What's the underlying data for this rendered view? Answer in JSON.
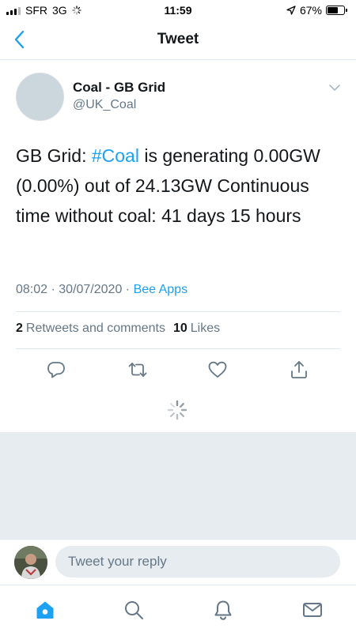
{
  "status_bar": {
    "carrier": "SFR",
    "network": "3G",
    "time": "11:59",
    "battery": "67%",
    "battery_level": 0.67
  },
  "nav": {
    "title": "Tweet"
  },
  "tweet": {
    "display_name": "Coal - GB Grid",
    "handle": "@UK_Coal",
    "text_before": "GB Grid: ",
    "hashtag": "#Coal",
    "text_after": " is generating 0.00GW (0.00%) out of 24.13GW Continuous time without coal: 41 days 15 hours",
    "time": "08:02",
    "date": "30/07/2020",
    "separator": " · ",
    "source": "Bee Apps"
  },
  "stats": {
    "retweets_count": "2",
    "retweets_label": "Retweets and comments",
    "likes_count": "10",
    "likes_label": "Likes"
  },
  "reply": {
    "placeholder": "Tweet your reply"
  },
  "colors": {
    "accent": "#1da1f2",
    "secondary_text": "#657786",
    "background_grey": "#e6ecf0"
  },
  "icons": {
    "actions": [
      "reply-icon",
      "retweet-icon",
      "like-icon",
      "share-icon"
    ],
    "tabs": [
      "home-icon",
      "search-icon",
      "notifications-icon",
      "messages-icon"
    ]
  }
}
